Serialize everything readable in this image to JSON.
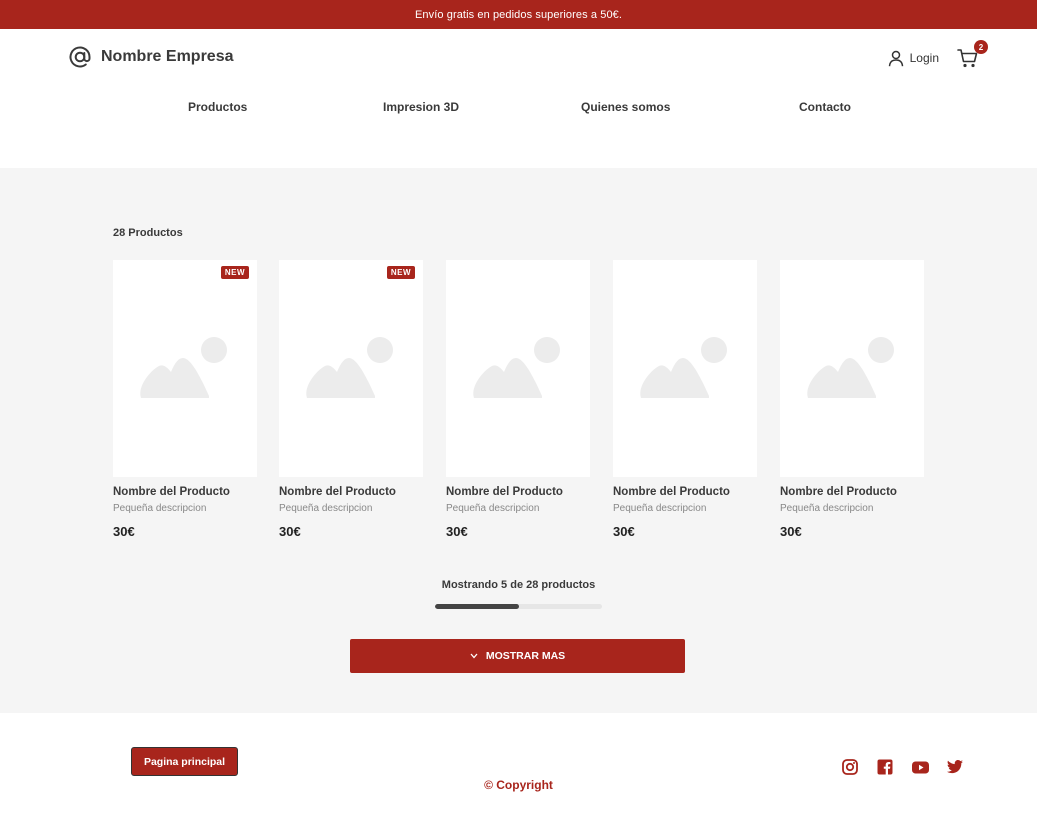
{
  "banner": {
    "text": "Envío gratis en pedidos superiores a 50€."
  },
  "header": {
    "brand_name": "Nombre Empresa",
    "login_label": "Login",
    "cart_count": "2"
  },
  "nav": [
    {
      "label": "Productos"
    },
    {
      "label": "Impresion 3D"
    },
    {
      "label": "Quienes somos"
    },
    {
      "label": "Contacto"
    }
  ],
  "listing": {
    "count_label": "28 Productos",
    "products": [
      {
        "name": "Nombre del Producto",
        "description": "Pequeña descripcion",
        "price": "30€",
        "badge": "NEW"
      },
      {
        "name": "Nombre del Producto",
        "description": "Pequeña descripcion",
        "price": "30€",
        "badge": "NEW"
      },
      {
        "name": "Nombre del Producto",
        "description": "Pequeña descripcion",
        "price": "30€",
        "badge": ""
      },
      {
        "name": "Nombre del Producto",
        "description": "Pequeña descripcion",
        "price": "30€",
        "badge": ""
      },
      {
        "name": "Nombre del Producto",
        "description": "Pequeña descripcion",
        "price": "30€",
        "badge": ""
      }
    ],
    "showing_text": "Mostrando 5 de 28 productos",
    "progress_fraction": 0.5,
    "more_button_label": "MOSTRAR MAS"
  },
  "footer": {
    "home_button_label": "Pagina principal",
    "copyright": "© Copyright",
    "social_icons": [
      "instagram-icon",
      "facebook-icon",
      "youtube-icon",
      "twitter-icon"
    ]
  },
  "colors": {
    "accent": "#a8251c",
    "background": "#f5f5f5",
    "placeholder": "#ececec"
  }
}
